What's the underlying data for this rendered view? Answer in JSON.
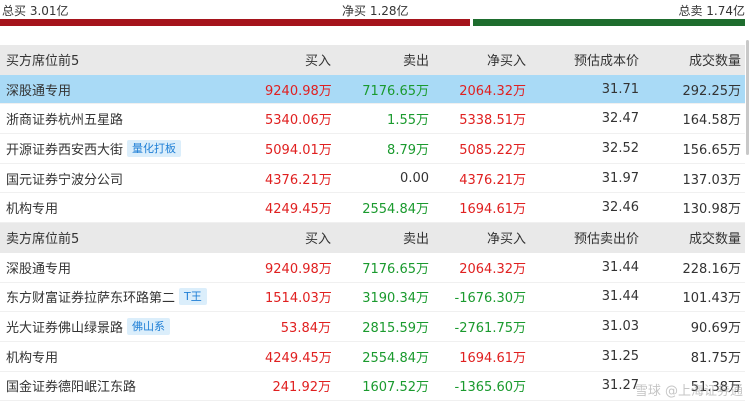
{
  "summary": {
    "total_buy": "总买 3.01亿",
    "net_buy": "净买 1.28亿",
    "total_sell": "总卖 1.74亿",
    "buy_fraction": 0.634
  },
  "colors": {
    "red": "#e02020",
    "green": "#1a9a2e",
    "bar_red": "#a5141c",
    "bar_green": "#1e6d2e",
    "highlight": "#a9daf6"
  },
  "buy_section": {
    "headers": [
      "买方席位前5",
      "买入",
      "卖出",
      "净买入",
      "预估成本价",
      "成交数量"
    ],
    "rows": [
      {
        "name": "深股通专用",
        "tag": "",
        "buy": "9240.98万",
        "sell": "7176.65万",
        "net": "2064.32万",
        "price": "31.71",
        "volume": "292.25万"
      },
      {
        "name": "浙商证券杭州五星路",
        "tag": "",
        "buy": "5340.06万",
        "sell": "1.55万",
        "net": "5338.51万",
        "price": "32.47",
        "volume": "164.58万"
      },
      {
        "name": "开源证券西安西大街",
        "tag": "量化打板",
        "buy": "5094.01万",
        "sell": "8.79万",
        "net": "5085.22万",
        "price": "32.52",
        "volume": "156.65万"
      },
      {
        "name": "国元证券宁波分公司",
        "tag": "",
        "buy": "4376.21万",
        "sell": "0.00",
        "net": "4376.21万",
        "price": "31.97",
        "volume": "137.03万"
      },
      {
        "name": "机构专用",
        "tag": "",
        "buy": "4249.45万",
        "sell": "2554.84万",
        "net": "1694.61万",
        "price": "32.46",
        "volume": "130.98万"
      }
    ]
  },
  "sell_section": {
    "headers": [
      "卖方席位前5",
      "买入",
      "卖出",
      "净买入",
      "预估卖出价",
      "成交数量"
    ],
    "rows": [
      {
        "name": "深股通专用",
        "tag": "",
        "buy": "9240.98万",
        "sell": "7176.65万",
        "net": "2064.32万",
        "price": "31.44",
        "volume": "228.16万"
      },
      {
        "name": "东方财富证券拉萨东环路第二",
        "tag": "T王",
        "buy": "1514.03万",
        "sell": "3190.34万",
        "net": "-1676.30万",
        "price": "31.44",
        "volume": "101.43万"
      },
      {
        "name": "光大证券佛山绿景路",
        "tag": "佛山系",
        "buy": "53.84万",
        "sell": "2815.59万",
        "net": "-2761.75万",
        "price": "31.03",
        "volume": "90.69万"
      },
      {
        "name": "机构专用",
        "tag": "",
        "buy": "4249.45万",
        "sell": "2554.84万",
        "net": "1694.61万",
        "price": "31.25",
        "volume": "81.75万"
      },
      {
        "name": "国金证券德阳岷江东路",
        "tag": "",
        "buy": "241.92万",
        "sell": "1607.52万",
        "net": "-1365.60万",
        "price": "31.27",
        "volume": "51.38万"
      }
    ]
  },
  "watermark": "雪球 @上海证券通"
}
